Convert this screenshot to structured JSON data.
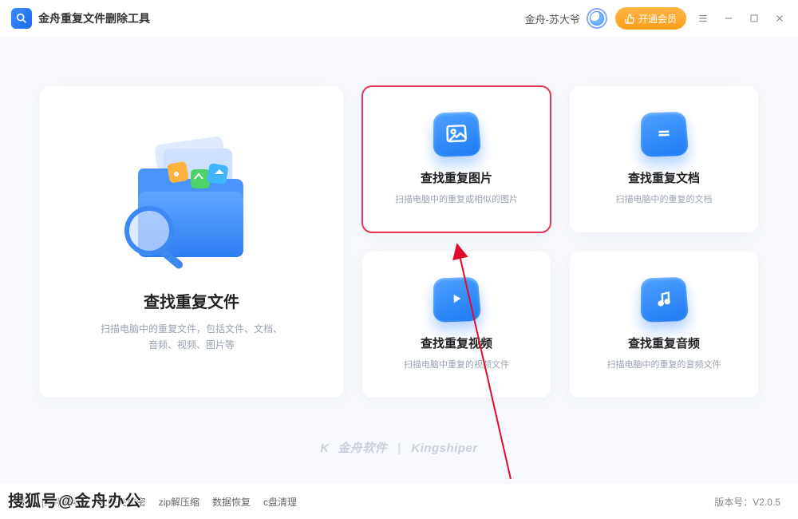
{
  "header": {
    "app_title": "金舟重复文件删除工具",
    "user_name": "金舟-苏大爷",
    "vip_label": "开通会员"
  },
  "main_card": {
    "title": "查找重复文件",
    "subtitle": "扫描电脑中的重复文件，包括文件、文档、\n音频、视频、图片等"
  },
  "cards": [
    {
      "title": "查找重复图片",
      "subtitle": "扫描电脑中的重复或相似的图片",
      "icon": "image",
      "selected": true
    },
    {
      "title": "查找重复文档",
      "subtitle": "扫描电脑中的重复的文档",
      "icon": "doc",
      "selected": false
    },
    {
      "title": "查找重复视频",
      "subtitle": "扫描电脑中重复的视频文件",
      "icon": "video",
      "selected": false
    },
    {
      "title": "查找重复音频",
      "subtitle": "扫描电脑中的重复的音频文件",
      "icon": "audio",
      "selected": false
    }
  ],
  "brand": {
    "cn": "金舟软件",
    "en": "Kingshiper"
  },
  "footer": {
    "links": [
      "[应用推荐]",
      "文件夹加密",
      "zip解压缩",
      "数据恢复",
      "c盘清理"
    ],
    "version_label": "版本号：",
    "version": "V2.0.5"
  },
  "watermark": "搜狐号@金舟办公"
}
